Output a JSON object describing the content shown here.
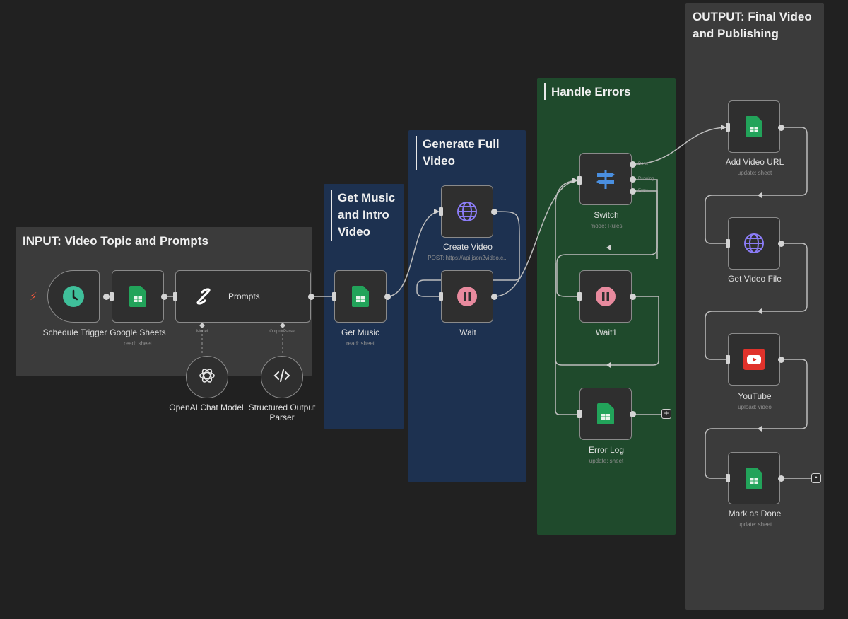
{
  "groups": {
    "input": "INPUT: Video Topic and Prompts",
    "music": "Get Music and Intro Video",
    "generate": "Generate Full Video",
    "errors": "Handle Errors",
    "output": "OUTPUT: Final Video and Publishing"
  },
  "nodes": {
    "schedule": {
      "label": "Schedule Trigger",
      "icon": "clock-icon"
    },
    "sheets": {
      "label": "Google Sheets",
      "subtitle": "read: sheet",
      "icon": "google-sheets-icon"
    },
    "prompts": {
      "label": "Prompts",
      "icon": "link-icon"
    },
    "openai": {
      "label": "OpenAI Chat Model",
      "icon": "openai-icon"
    },
    "parser": {
      "label": "Structured Output Parser",
      "icon": "code-icon"
    },
    "get_music": {
      "label": "Get Music",
      "subtitle": "read: sheet",
      "icon": "google-sheets-icon"
    },
    "create_video": {
      "label": "Create Video",
      "subtitle": "POST: https://api.json2video.c...",
      "icon": "globe-icon"
    },
    "wait": {
      "label": "Wait",
      "icon": "pause-icon"
    },
    "switch": {
      "label": "Switch",
      "subtitle": "mode: Rules",
      "icon": "signpost-icon"
    },
    "wait1": {
      "label": "Wait1",
      "icon": "pause-icon"
    },
    "error_log": {
      "label": "Error Log",
      "subtitle": "update: sheet",
      "icon": "google-sheets-icon"
    },
    "add_video_url": {
      "label": "Add Video URL",
      "subtitle": "update: sheet",
      "icon": "google-sheets-icon"
    },
    "get_video_file": {
      "label": "Get Video File",
      "icon": "globe-icon"
    },
    "youtube": {
      "label": "YouTube",
      "subtitle": "upload: video",
      "icon": "youtube-icon"
    },
    "mark_done": {
      "label": "Mark as Done",
      "subtitle": "update: sheet",
      "icon": "google-sheets-icon"
    }
  },
  "ports": {
    "prompts_model": "Model",
    "prompts_parser": "Output Parser",
    "switch_done": "Done",
    "switch_running": "Running",
    "switch_error": "Error"
  },
  "colors": {
    "canvas": "#212121",
    "group_gray": "#3b3b3b",
    "group_blue": "#1d3150",
    "group_green": "#1f4a2c",
    "sheets_green": "#22a35a",
    "clock_teal": "#3fbf9a",
    "globe_purple": "#8b7cf6",
    "pause_pink": "#e88a9e",
    "switch_blue": "#4a8fe0",
    "youtube_red": "#e0322b"
  }
}
